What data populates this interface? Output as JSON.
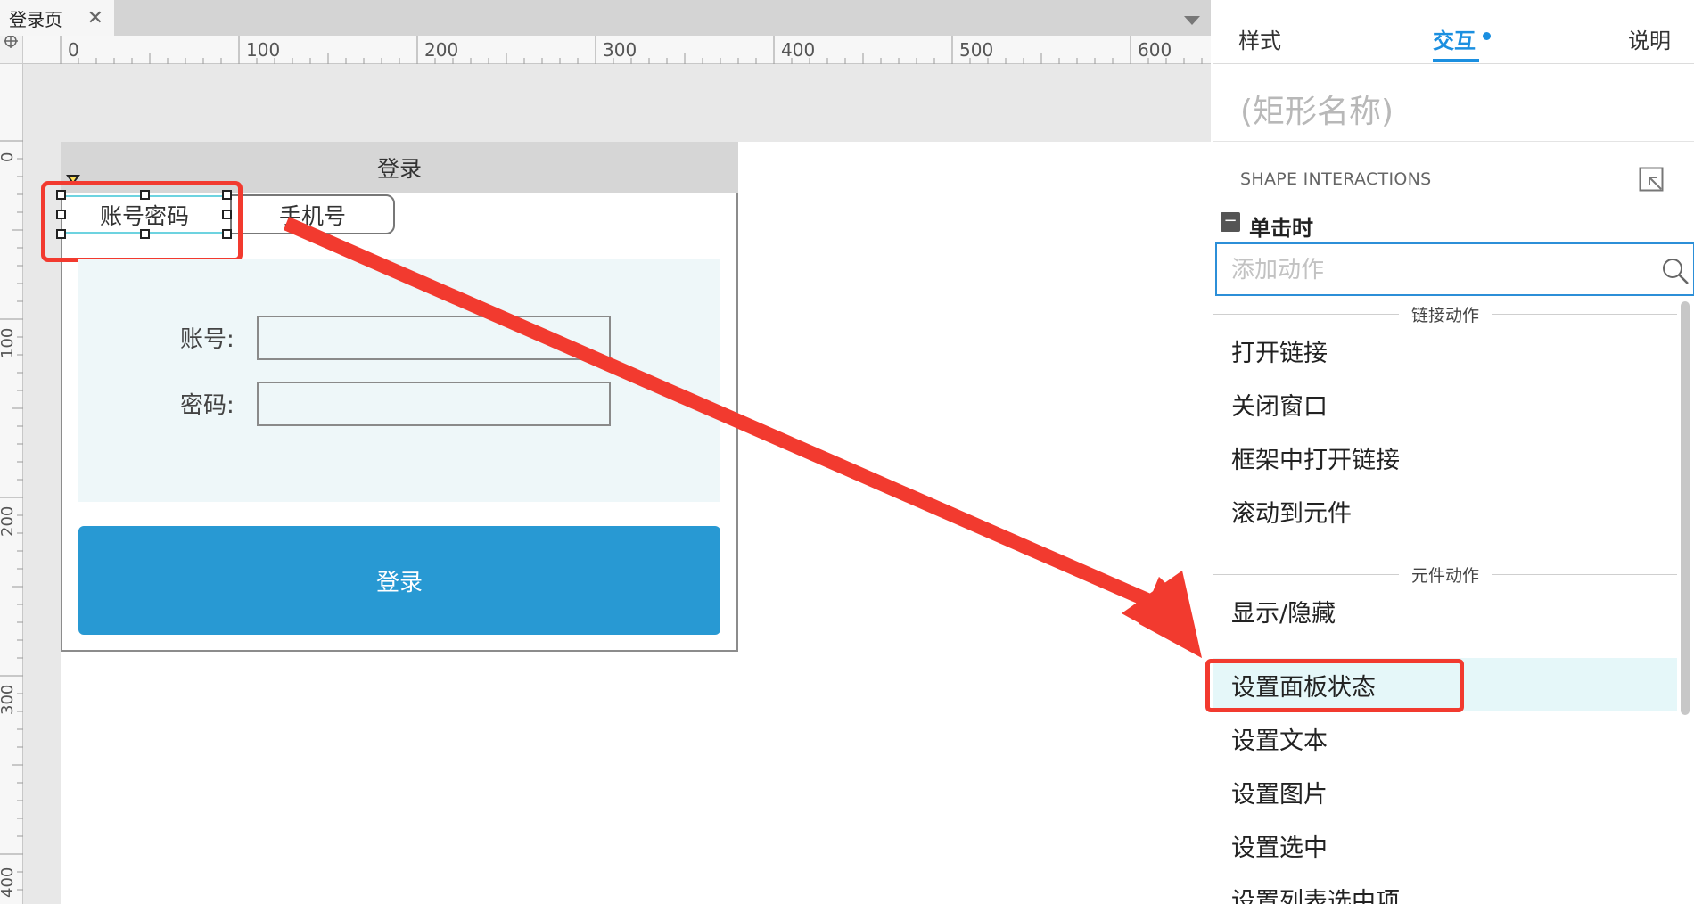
{
  "document_tab": {
    "title": "登录页",
    "close_glyph": "✕"
  },
  "ruler": {
    "horizontal_labels": [
      "0",
      "100",
      "200",
      "300",
      "400",
      "500",
      "600"
    ],
    "vertical_labels": [
      "0",
      "100",
      "200",
      "300",
      "400"
    ]
  },
  "prototype": {
    "header_title": "登录",
    "tab_account": "账号密码",
    "tab_phone": "手机号",
    "account_label": "账号:",
    "password_label": "密码:",
    "login_button": "登录"
  },
  "inspector": {
    "tabs": {
      "style": "样式",
      "interaction": "交互",
      "notes": "说明"
    },
    "shape_name_placeholder": "(矩形名称)",
    "section_title": "SHAPE INTERACTIONS",
    "event_toggle": "−",
    "event_label": "单击时",
    "search_placeholder": "添加动作",
    "groups": [
      {
        "title": "链接动作",
        "items": [
          "打开链接",
          "关闭窗口",
          "框架中打开链接",
          "滚动到元件"
        ]
      },
      {
        "title": "元件动作",
        "items": [
          "显示/隐藏",
          "设置面板状态",
          "设置文本",
          "设置图片",
          "设置选中",
          "设置列表选中项"
        ]
      }
    ],
    "selected_action": "设置面板状态"
  },
  "colors": {
    "accent_blue": "#1b8fe0",
    "annotation_red": "#f23a2f",
    "login_button_blue": "#2899d3",
    "selection_cyan": "#6dd3e0"
  },
  "icons": {
    "crosshair": "crosshair-icon",
    "dropdown": "chevron-down-icon",
    "expand": "expand-popout-icon",
    "search": "search-icon",
    "annotation_arrow": "red-arrow"
  }
}
